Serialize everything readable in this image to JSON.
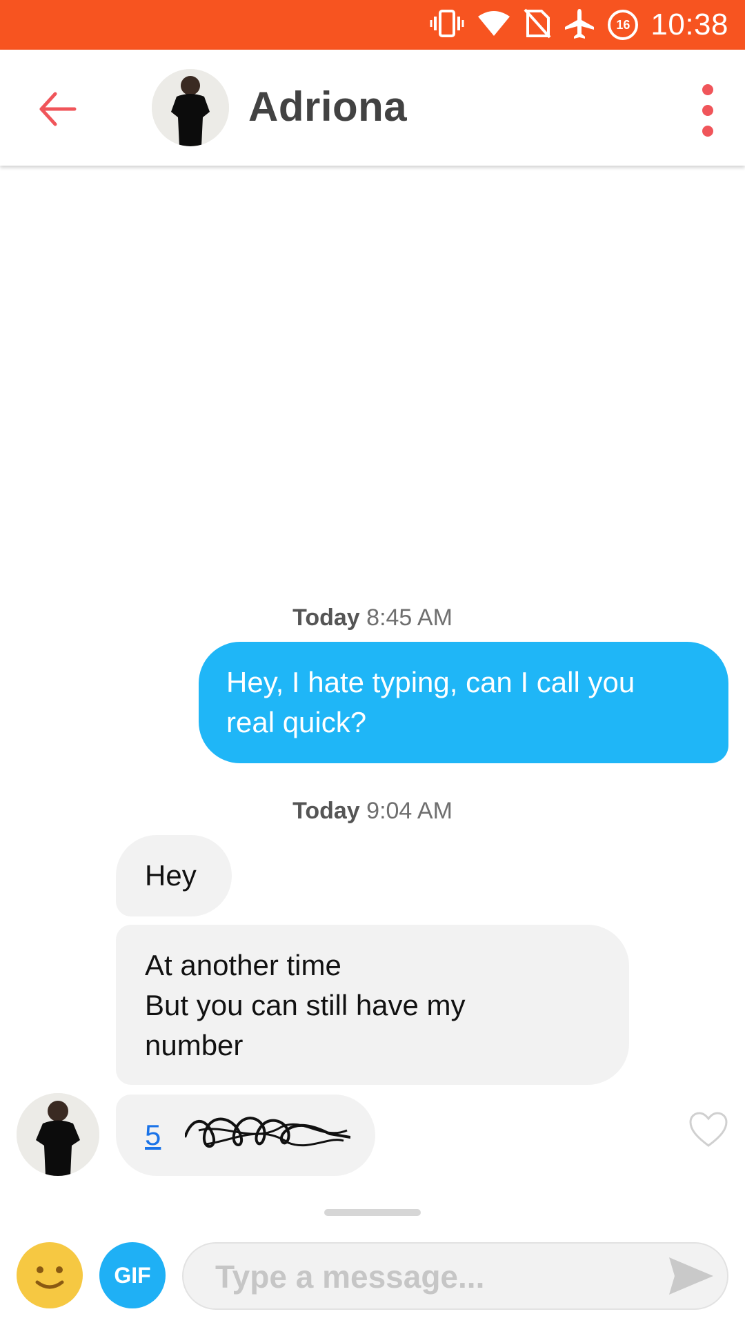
{
  "status_bar": {
    "time": "10:38",
    "battery_level": "16",
    "icons": [
      "vibrate-icon",
      "wifi-icon",
      "no-sim-icon",
      "airplane-mode-icon",
      "battery-saver-icon"
    ]
  },
  "header": {
    "contact_name": "Adriona",
    "back_icon": "arrow-left-icon",
    "menu_icon": "more-vertical-icon"
  },
  "conversation": {
    "groups": [
      {
        "timestamp_day": "Today",
        "timestamp_time": "8:45 AM"
      },
      {
        "timestamp_day": "Today",
        "timestamp_time": "9:04 AM"
      }
    ],
    "outgoing": {
      "line1": "Hey, I hate typing, can I call you",
      "line2": "real quick?"
    },
    "incoming": {
      "msg1": "Hey",
      "msg2_line1": "At another time",
      "msg2_line2": "But you can still have my",
      "msg2_line3": "number",
      "msg3_phone_visible": "5"
    }
  },
  "composer": {
    "placeholder": "Type a message...",
    "gif_label": "GIF"
  },
  "colors": {
    "status_bar": "#f75420",
    "accent_red": "#f0555a",
    "outgoing_bubble": "#1fb6f7",
    "incoming_bubble": "#f2f2f2",
    "gif_button": "#1fb0f5",
    "emoji_button": "#f6c842"
  }
}
